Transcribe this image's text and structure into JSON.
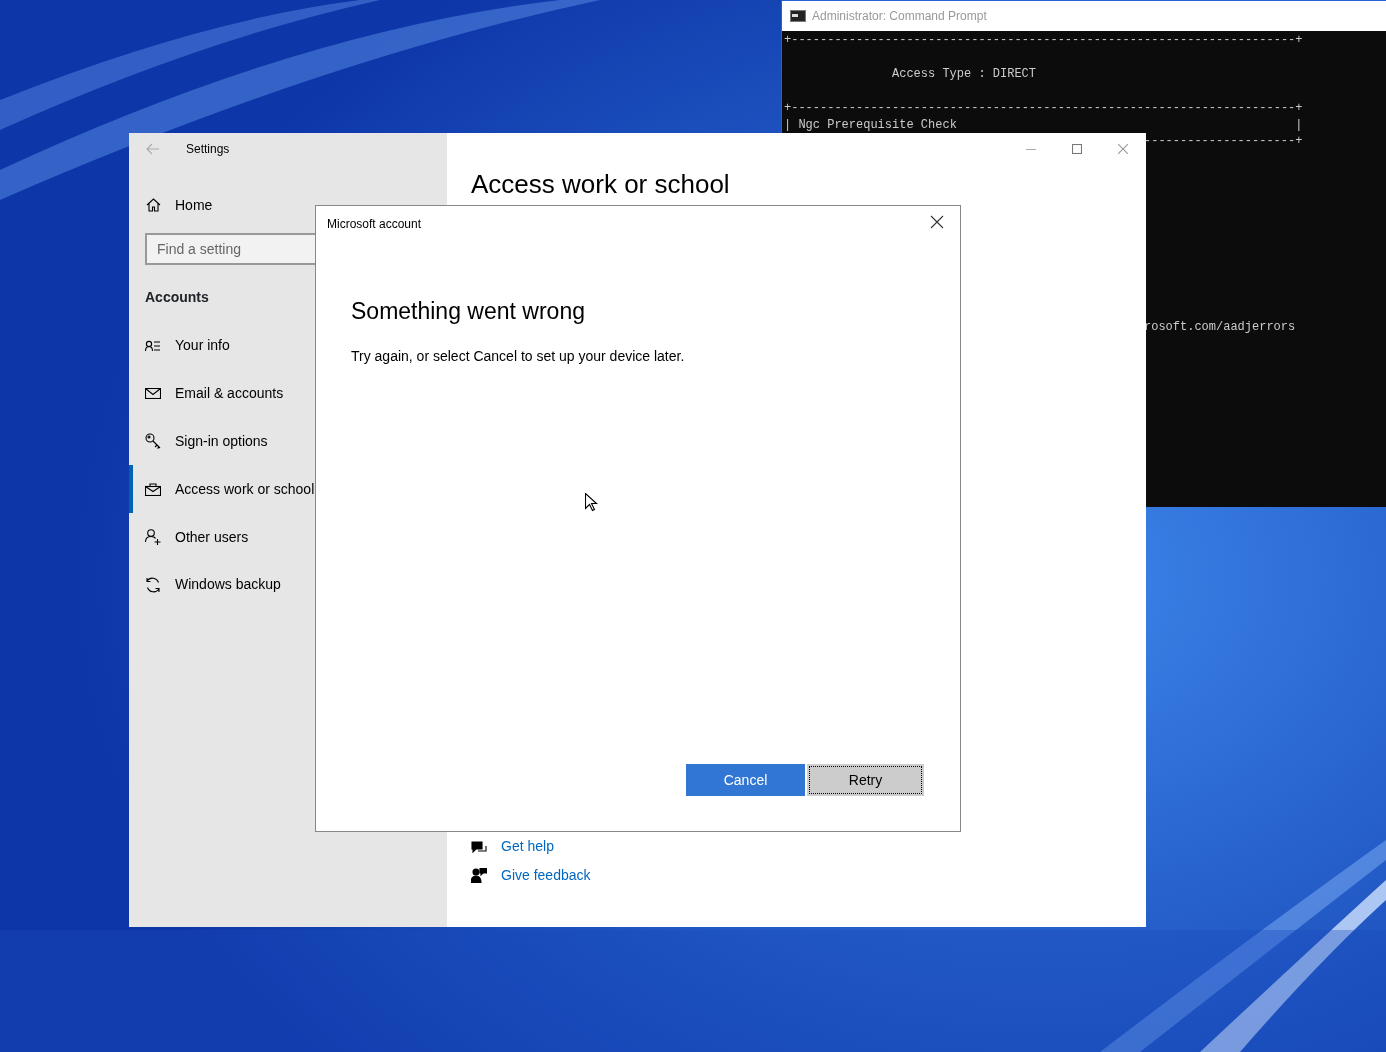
{
  "console_window": {
    "title": "Administrator: Command Prompt",
    "lines": [
      {
        "text": "+----------------------------------------------------------------------+"
      },
      {
        "text": "               Access Type : DIRECT"
      },
      {
        "text": "+----------------------------------------------------------------------+"
      },
      {
        "text": "| Ngc Prerequisite Check                                               |"
      },
      {
        "text": "                                                  ---------------------+"
      },
      {
        "text": "                                                  rosoft.com/aadjerrors"
      }
    ]
  },
  "settings_window": {
    "title": "Settings",
    "sidebar": {
      "home": "Home",
      "search": {
        "placeholder": "Find a setting"
      },
      "section": "Accounts",
      "items": [
        {
          "label": "Your info",
          "kind": "person-list",
          "selected": false
        },
        {
          "label": "Email & accounts",
          "kind": "mail",
          "selected": false
        },
        {
          "label": "Sign-in options",
          "kind": "key",
          "selected": false
        },
        {
          "label": "Access work or school",
          "kind": "briefcase",
          "selected": true
        },
        {
          "label": "Other users",
          "kind": "person-add",
          "selected": false
        },
        {
          "label": "Windows backup",
          "kind": "sync",
          "selected": false
        }
      ]
    },
    "page": {
      "heading": "Access work or school",
      "links": [
        {
          "label": "Get help",
          "kind": "help"
        },
        {
          "label": "Give feedback",
          "kind": "feedback"
        }
      ]
    }
  },
  "dialog": {
    "title": "Microsoft account",
    "heading": "Something went wrong",
    "message": "Try again, or select Cancel to set up your device later.",
    "buttons": [
      {
        "label": "Cancel",
        "kind": "primary",
        "focused": false
      },
      {
        "label": "Retry",
        "kind": "secondary",
        "focused": true
      }
    ]
  }
}
